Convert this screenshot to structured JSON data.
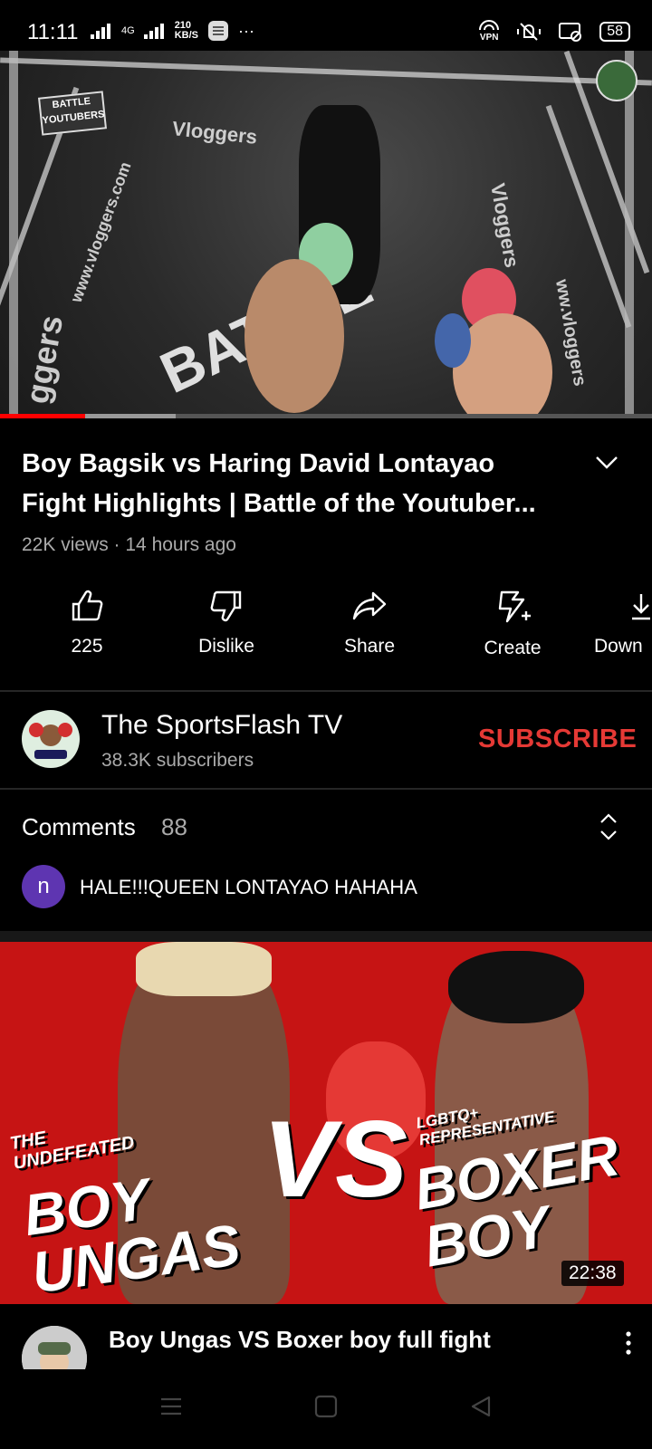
{
  "status_bar": {
    "time": "11:11",
    "network": "4G",
    "speed_value": "210",
    "speed_unit": "KB/S",
    "vpn_label": "VPN",
    "battery": "58"
  },
  "player": {
    "progress_fraction": 0.13,
    "buffer_fraction": 0.27,
    "progress_color": "#ff0000"
  },
  "video": {
    "title": "Boy Bagsik vs Haring David Lontayao Fight Highlights | Battle of the Youtuber...",
    "meta": "22K views · 14 hours ago"
  },
  "actions": [
    {
      "label": "225",
      "icon": "thumbs-up-icon"
    },
    {
      "label": "Dislike",
      "icon": "thumbs-down-icon"
    },
    {
      "label": "Share",
      "icon": "share-icon"
    },
    {
      "label": "Create",
      "icon": "create-icon"
    },
    {
      "label": "Down",
      "icon": "download-icon"
    }
  ],
  "channel": {
    "name": "The SportsFlash TV",
    "subscribers": "38.3K subscribers",
    "subscribe_label": "SUBSCRIBE",
    "subscribe_color": "#e53935"
  },
  "comments": {
    "title": "Comments",
    "count": "88",
    "first": {
      "avatar_letter": "n",
      "text": "HALE!!!QUEEN LONTAYAO HAHAHA"
    }
  },
  "next_video": {
    "thumb_left_small": "THE UNDEFEATED",
    "thumb_left_big": "BOY UNGAS",
    "thumb_vs": "VS",
    "thumb_right_small": "LGBTQ+ REPRESENTATIVE",
    "thumb_right_big": "BOXER BOY",
    "duration": "22:38",
    "title": "Boy Ungas VS Boxer boy full fight"
  }
}
